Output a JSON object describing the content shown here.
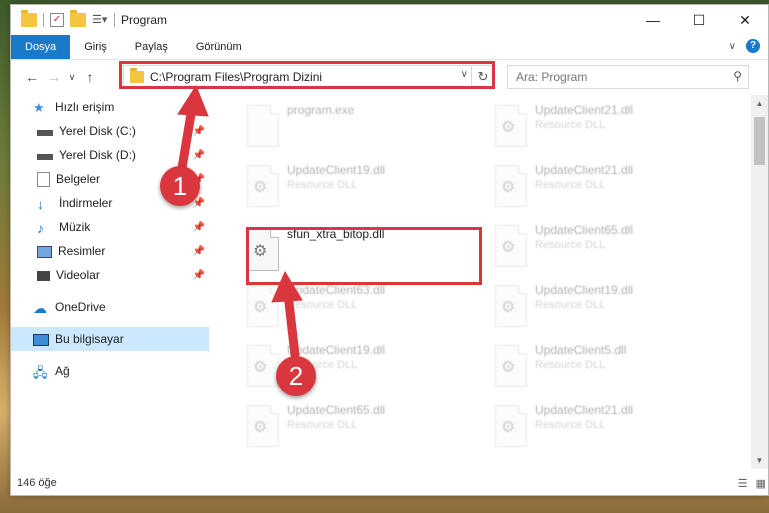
{
  "window": {
    "title": "Program"
  },
  "ribbon": {
    "tabs": [
      "Dosya",
      "Giriş",
      "Paylaş",
      "Görünüm"
    ]
  },
  "address": {
    "path": "C:\\Program Files\\Program Dizini"
  },
  "search": {
    "placeholder": "Ara: Program"
  },
  "sidebar": {
    "quick_access": "Hızlı erişim",
    "items": [
      {
        "label": "Yerel Disk (C:)",
        "icon": "drive-icon",
        "pinned": true
      },
      {
        "label": "Yerel Disk (D:)",
        "icon": "drive-icon",
        "pinned": true
      },
      {
        "label": "Belgeler",
        "icon": "documents-icon",
        "pinned": true
      },
      {
        "label": "İndirmeler",
        "icon": "download-icon",
        "pinned": true
      },
      {
        "label": "Müzik",
        "icon": "music-icon",
        "pinned": true
      },
      {
        "label": "Resimler",
        "icon": "pictures-icon",
        "pinned": true
      },
      {
        "label": "Videolar",
        "icon": "videos-icon",
        "pinned": true
      }
    ],
    "onedrive": "OneDrive",
    "this_pc": "Bu bilgisayar",
    "network": "Ağ"
  },
  "files": [
    {
      "name": "program.exe",
      "type": ""
    },
    {
      "name": "UpdateClient21.dll",
      "type": "Resource DLL"
    },
    {
      "name": "UpdateClient19.dll",
      "type": "Resource DLL"
    },
    {
      "name": "UpdateClient21.dll",
      "type": "Resource DLL"
    },
    {
      "name": "sfun_xtra_bitop.dll",
      "type": ""
    },
    {
      "name": "UpdateClient65.dll",
      "type": "Resource DLL"
    },
    {
      "name": "UpdateClient63.dll",
      "type": "Resource DLL"
    },
    {
      "name": "UpdateClient19.dll",
      "type": "Resource DLL"
    },
    {
      "name": "UpdateClient19.dll",
      "type": "Resource DLL"
    },
    {
      "name": "UpdateClient5.dll",
      "type": "Resource DLL"
    },
    {
      "name": "UpdateClient65.dll",
      "type": "Resource DLL"
    },
    {
      "name": "UpdateClient21.dll",
      "type": "Resource DLL"
    }
  ],
  "status": {
    "count": "146 öğe"
  },
  "annotations": {
    "step1": "1",
    "step2": "2"
  },
  "colors": {
    "accent": "#1979ca",
    "highlight": "#d9363e"
  }
}
